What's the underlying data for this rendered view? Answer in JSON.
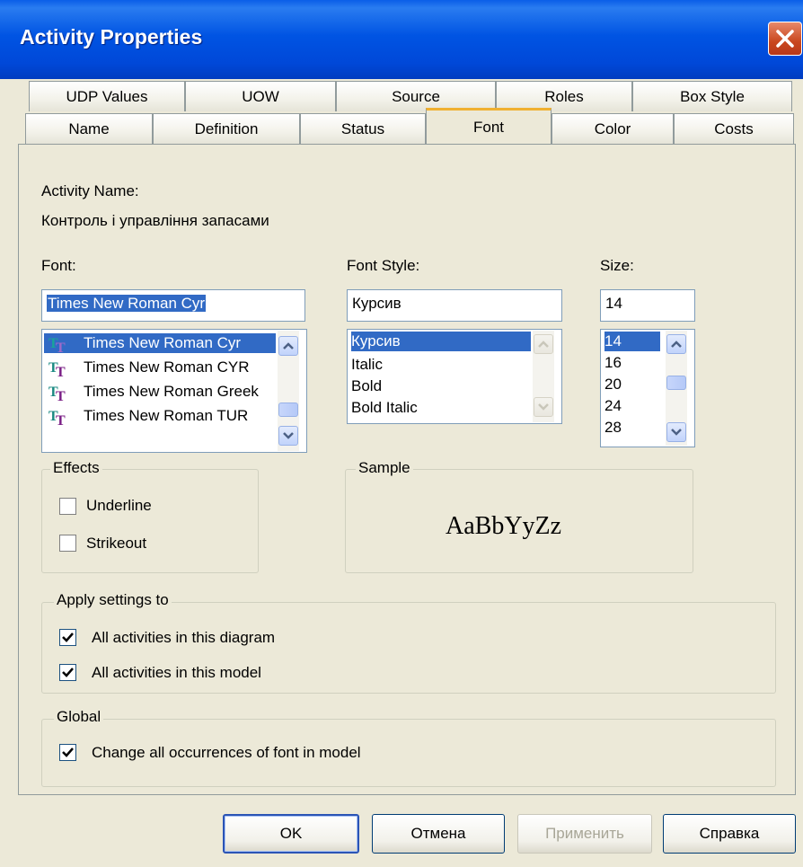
{
  "window": {
    "title": "Activity Properties"
  },
  "tabs": {
    "row1": [
      "UDP Values",
      "UOW",
      "Source",
      "Roles",
      "Box Style"
    ],
    "row2": [
      "Name",
      "Definition",
      "Status",
      "Font",
      "Color",
      "Costs"
    ],
    "active": "Font"
  },
  "activity": {
    "name_label": "Activity Name:",
    "name_value": "Контроль і управління запасами"
  },
  "font": {
    "label": "Font:",
    "value": "Times New Roman Cyr",
    "list": [
      "Times New Roman Cyr",
      "Times New Roman CYR",
      "Times New Roman Greek",
      "Times New Roman TUR"
    ],
    "selected_index": 0
  },
  "font_style": {
    "label": "Font Style:",
    "value": "Курсив",
    "list": [
      "Курсив",
      "Italic",
      "Bold",
      "Bold Italic"
    ],
    "selected_index": 0
  },
  "size": {
    "label": "Size:",
    "value": "14",
    "list": [
      "14",
      "16",
      "20",
      "24",
      "28"
    ],
    "selected_index": 0
  },
  "effects": {
    "title": "Effects",
    "underline": {
      "label": "Underline",
      "checked": false
    },
    "strikeout": {
      "label": "Strikeout",
      "checked": false
    }
  },
  "sample": {
    "title": "Sample",
    "text": "AaBbYyZz"
  },
  "apply": {
    "title": "Apply settings to",
    "diagram": {
      "label": "All activities in this diagram",
      "checked": true
    },
    "model": {
      "label": "All activities in this model",
      "checked": true
    }
  },
  "global": {
    "title": "Global",
    "change_all": {
      "label": "Change all occurrences of font in model",
      "checked": true
    }
  },
  "buttons": {
    "ok": "OK",
    "cancel": "Отмена",
    "apply": "Применить",
    "help": "Справка"
  },
  "colors": {
    "titlebar": "#0054e3",
    "selection": "#316ac5",
    "dialog_bg": "#ece9d8"
  }
}
